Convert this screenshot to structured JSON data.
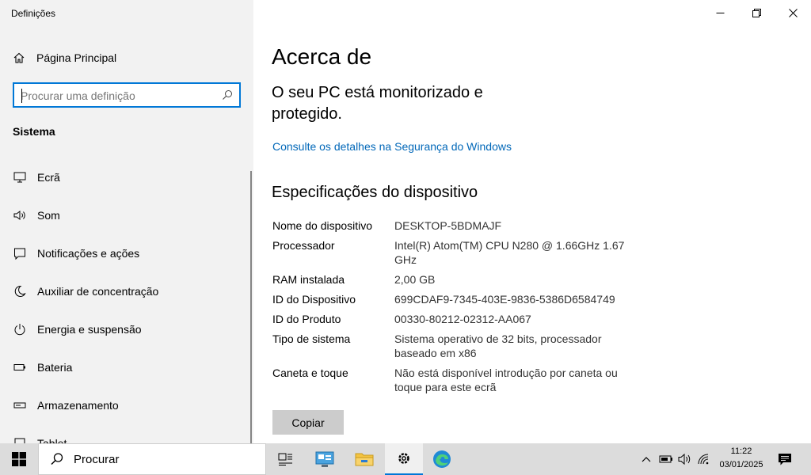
{
  "window": {
    "title": "Definições"
  },
  "sidebar": {
    "home_label": "Página Principal",
    "search_placeholder": "Procurar uma definição",
    "section": "Sistema",
    "items": [
      {
        "label": "Ecrã",
        "icon": "monitor-icon"
      },
      {
        "label": "Som",
        "icon": "speaker-icon"
      },
      {
        "label": "Notificações e ações",
        "icon": "notification-icon"
      },
      {
        "label": "Auxiliar de concentração",
        "icon": "moon-icon"
      },
      {
        "label": "Energia e suspensão",
        "icon": "power-icon"
      },
      {
        "label": "Bateria",
        "icon": "battery-icon"
      },
      {
        "label": "Armazenamento",
        "icon": "storage-icon"
      },
      {
        "label": "Tablet",
        "icon": "tablet-icon"
      }
    ]
  },
  "main": {
    "title": "Acerca de",
    "protection_text": "O seu PC está monitorizado e protegido.",
    "security_link": "Consulte os detalhes na Segurança do Windows",
    "spec_title": "Especificações do dispositivo",
    "specs": [
      {
        "key": "Nome do dispositivo",
        "value": "DESKTOP-5BDMAJF"
      },
      {
        "key": "Processador",
        "value": "Intel(R) Atom(TM) CPU N280   @ 1.66GHz   1.67 GHz"
      },
      {
        "key": "RAM instalada",
        "value": "2,00 GB"
      },
      {
        "key": "ID do Dispositivo",
        "value": "699CDAF9-7345-403E-9836-5386D6584749"
      },
      {
        "key": "ID do Produto",
        "value": "00330-80212-02312-AA067"
      },
      {
        "key": "Tipo de sistema",
        "value": "Sistema operativo de 32 bits, processador baseado em x86"
      },
      {
        "key": "Caneta e toque",
        "value": "Não está disponível introdução por caneta ou toque para este ecrã"
      }
    ],
    "copy_label": "Copiar"
  },
  "taskbar": {
    "search_label": "Procurar",
    "time": "11:22",
    "date": "03/01/2025",
    "accent": "#0078d7"
  }
}
